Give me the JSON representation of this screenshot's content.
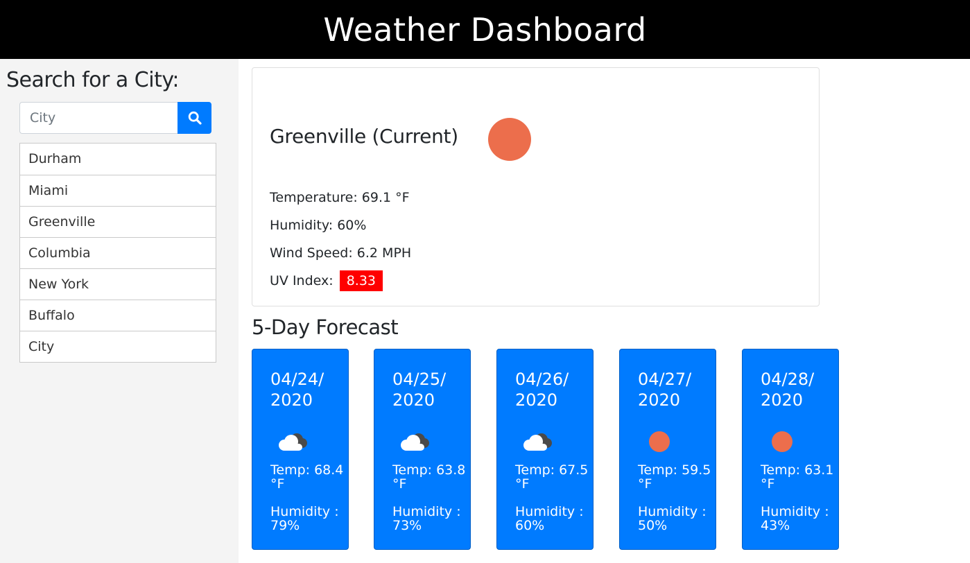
{
  "header": {
    "title": "Weather Dashboard"
  },
  "sidebar": {
    "heading": "Search for a City:",
    "search_placeholder": "City",
    "cities": [
      "Durham",
      "Miami",
      "Greenville",
      "Columbia",
      "New York",
      "Buffalo",
      "City"
    ]
  },
  "current": {
    "title": "Greenville (Current)",
    "icon": "sun-icon",
    "temperature": "Temperature: 69.1 °F",
    "humidity": "Humidity: 60%",
    "wind": "Wind Speed: 6.2 MPH",
    "uv_label": "UV Index:",
    "uv_value": "8.33",
    "uv_color": "#ff0000"
  },
  "forecast": {
    "title": "5-Day Forecast",
    "days": [
      {
        "date": "04/24/ 2020",
        "icon": "cloud-icon",
        "temp": "Temp: 68.4 °F",
        "humidity": "Humidity : 79%"
      },
      {
        "date": "04/25/ 2020",
        "icon": "cloud-icon",
        "temp": "Temp: 63.8 °F",
        "humidity": "Humidity : 73%"
      },
      {
        "date": "04/26/ 2020",
        "icon": "cloud-icon",
        "temp": "Temp: 67.5 °F",
        "humidity": "Humidity : 60%"
      },
      {
        "date": "04/27/ 2020",
        "icon": "sun-icon",
        "temp": "Temp: 59.5 °F",
        "humidity": "Humidity : 50%"
      },
      {
        "date": "04/28/ 2020",
        "icon": "sun-icon",
        "temp": "Temp: 63.1 °F",
        "humidity": "Humidity : 43%"
      }
    ]
  },
  "colors": {
    "accent": "#007bff",
    "sun": "#ec6e4c",
    "header_bg": "#000000",
    "sidebar_bg": "#f4f4f4"
  }
}
